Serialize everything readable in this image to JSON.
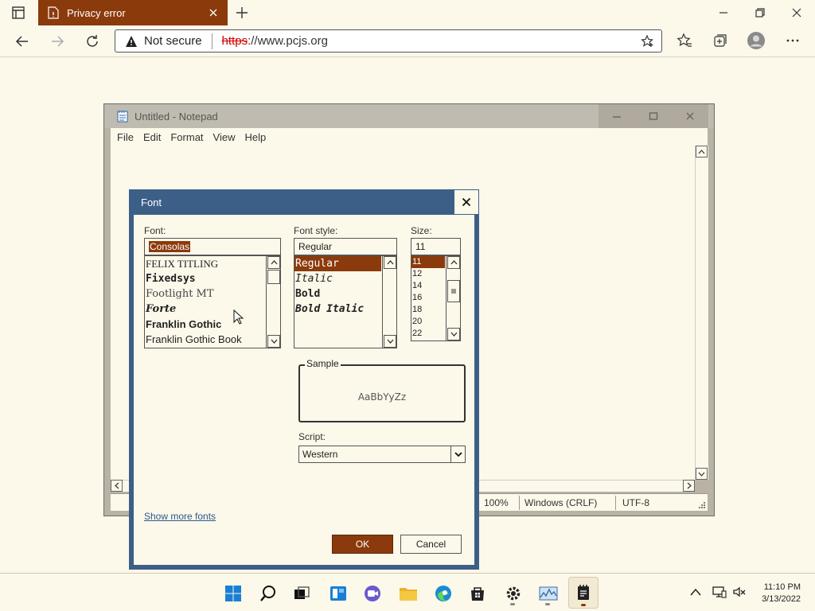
{
  "browser": {
    "tab_title": "Privacy error",
    "security_label": "Not secure",
    "url_scheme": "https",
    "url_rest": "://www.pcjs.org"
  },
  "notepad": {
    "title": "Untitled - Notepad",
    "menu": [
      "File",
      "Edit",
      "Format",
      "View",
      "Help"
    ],
    "status": {
      "zoom": "100%",
      "line_endings": "Windows (CRLF)",
      "encoding": "UTF-8"
    }
  },
  "font_dialog": {
    "title": "Font",
    "font_label": "Font:",
    "font_value": "Consolas",
    "fonts": [
      "FELIX TITLING",
      "Fixedsys",
      "Footlight MT",
      "Forte",
      "Franklin Gothic",
      "Franklin Gothic Book"
    ],
    "style_label": "Font style:",
    "style_value": "Regular",
    "styles": [
      "Regular",
      "Italic",
      "Bold",
      "Bold Italic"
    ],
    "size_label": "Size:",
    "size_value": "11",
    "sizes": [
      "11",
      "12",
      "14",
      "16",
      "18",
      "20",
      "22"
    ],
    "sample_label": "Sample",
    "sample_text": "AaBbYyZz",
    "script_label": "Script:",
    "script_value": "Western",
    "show_more": "Show more fonts",
    "ok": "OK",
    "cancel": "Cancel"
  },
  "taskbar": {
    "time": "11:10 PM",
    "date": "3/13/2022"
  },
  "colors": {
    "accent": "#8b3a0c",
    "dialog_border": "#3c5f87",
    "background": "#fcf8ea"
  }
}
